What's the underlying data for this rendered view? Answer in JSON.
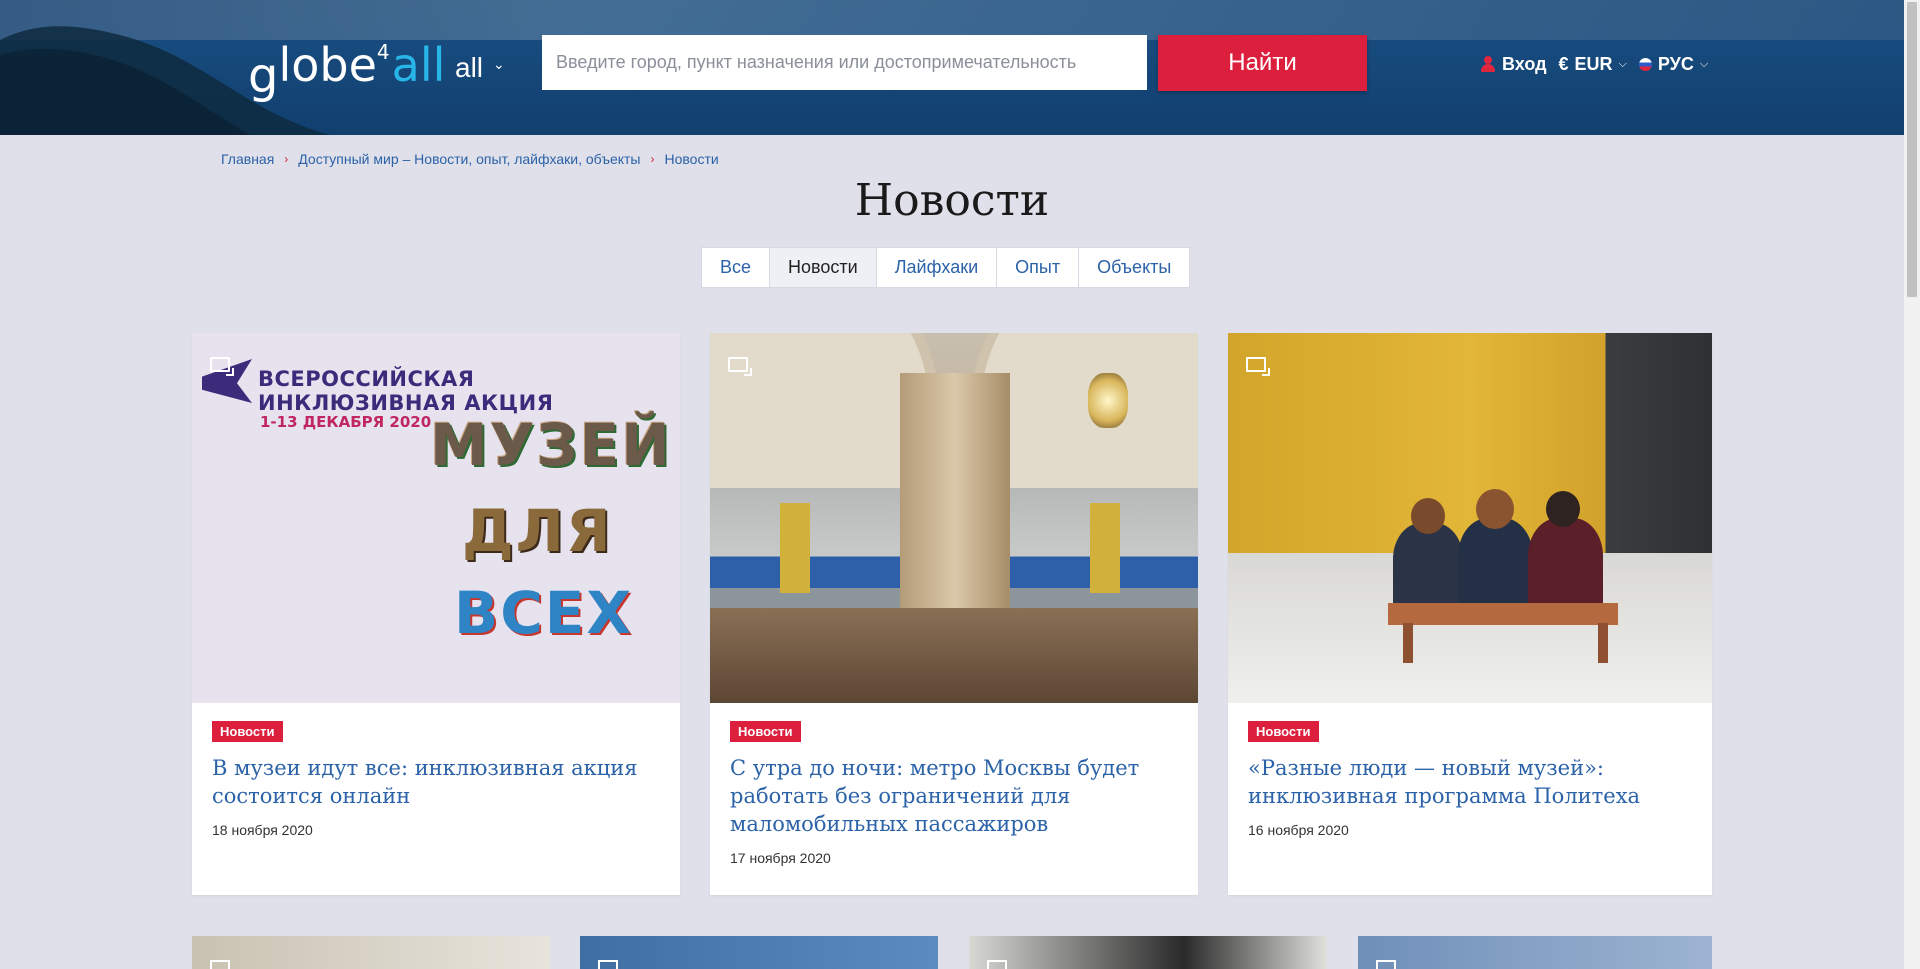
{
  "header": {
    "logo": {
      "g": "g",
      "lobe": "lobe",
      "four": "4",
      "all": "all"
    },
    "logo_sub": "all",
    "search": {
      "placeholder": "Введите город, пункт назначения или достопримечательность",
      "value": ""
    },
    "search_button": "Найти",
    "login_label": "Вход",
    "currency_symbol": "€",
    "currency_label": "EUR",
    "language_label": "РУС",
    "icons": {
      "user": "user-icon",
      "flag": "russia-flag-icon",
      "chevron": "chevron-down-icon"
    }
  },
  "breadcrumb": [
    {
      "label": "Главная"
    },
    {
      "label": "Доступный мир – Новости, опыт, лайфхаки, объекты"
    },
    {
      "label": "Новости"
    }
  ],
  "breadcrumb_separator": "›",
  "page_title": "Новости",
  "tabs": [
    {
      "label": "Все",
      "active": false
    },
    {
      "label": "Новости",
      "active": true
    },
    {
      "label": "Лайфхаки",
      "active": false
    },
    {
      "label": "Опыт",
      "active": false
    },
    {
      "label": "Объекты",
      "active": false
    }
  ],
  "cards": [
    {
      "category": "Новости",
      "title": "В музеи идут все: инклюзивная акция состоится онлайн",
      "date": "18 ноября 2020",
      "image": {
        "heading": "ВСЕРОССИЙСКАЯ ИНКЛЮЗИВНАЯ АКЦИЯ",
        "dates": "1-13 ДЕКАБРЯ 2020",
        "line1": "МУЗЕЙ",
        "line2": "ДЛЯ",
        "line3": "ВСЕХ"
      }
    },
    {
      "category": "Новости",
      "title": "С утра до ночи: метро Москвы будет работать без ограничений для маломобильных пассажиров",
      "date": "17 ноября 2020"
    },
    {
      "category": "Новости",
      "title": "«Разные люди — новый музей»: инклюзивная программа Политеха",
      "date": "16 ноября 2020"
    }
  ],
  "colors": {
    "accent": "#dc1f3c",
    "link": "#2b62a8",
    "header_bg": "#174a7d",
    "page_bg": "#dfe0ea"
  }
}
